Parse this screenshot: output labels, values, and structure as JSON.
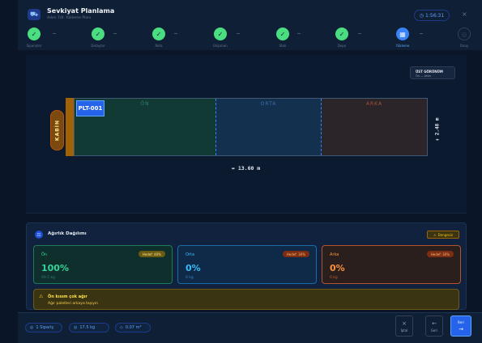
{
  "header": {
    "title": "Sevkiyat Planlama",
    "subtitle": "Adım 7/8: Yükleme Planı",
    "timer": "1:56:31",
    "close_label": "×"
  },
  "stepper": {
    "steps": [
      {
        "label": "Siparişler",
        "status": "done"
      },
      {
        "label": "Detaylar",
        "status": "done"
      },
      {
        "label": "Rota",
        "status": "done"
      },
      {
        "label": "Ekipman",
        "status": "done"
      },
      {
        "label": "Stok",
        "status": "done"
      },
      {
        "label": "Depo",
        "status": "done"
      },
      {
        "label": "Yükleme",
        "status": "active"
      },
      {
        "label": "Onay",
        "status": "future"
      }
    ]
  },
  "canvas": {
    "topview_title": "ÜST GÖRÜNÜM",
    "topview_sub": "Ön — Arka",
    "cabin_label": "KABİN",
    "zones": {
      "front": "ÖN",
      "mid": "ORTA",
      "back": "ARKA"
    },
    "pallet_label": "PLT-001",
    "height_label": "↕ 2.48 m",
    "length_label": "↔ 13.60 m"
  },
  "weight": {
    "title": "Ağırlık Dağılımı",
    "balance_badge": "Dengesiz",
    "cards": {
      "front": {
        "name": "Ön",
        "target": "Hedef: 40%",
        "percent": "100%",
        "kg": "99.5 kg"
      },
      "mid": {
        "name": "Orta",
        "target": "Hedef: 30%",
        "percent": "0%",
        "kg": "0 kg"
      },
      "back": {
        "name": "Arka",
        "target": "Hedef: 30%",
        "percent": "0%",
        "kg": "0 kg"
      }
    },
    "warning": {
      "title": "Ön kısım çok ağır",
      "detail": "Ağır paletleri arkaya taşıyın"
    }
  },
  "footer": {
    "orders": "1 Sipariş",
    "weight": "17.5 kg",
    "volume": "0.07 m³",
    "cancel": "İptal",
    "back": "Geri",
    "next": "İleri"
  },
  "colors": {
    "accent": "#2563eb",
    "success": "#4ade80",
    "warning": "#facc15"
  }
}
